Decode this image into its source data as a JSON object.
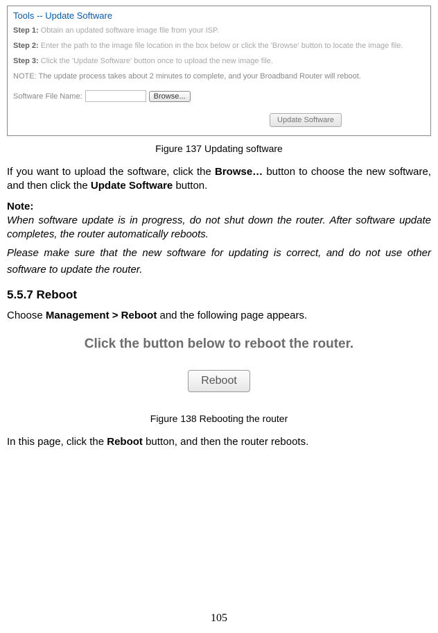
{
  "screenshot1": {
    "title": "Tools -- Update Software",
    "step1_label": "Step 1:",
    "step1_text": "Obtain an updated software image file from your ISP.",
    "step2_label": "Step 2:",
    "step2_text": "Enter the path to the image file location in the box below or click the 'Browse' button to locate the image file.",
    "step3_label": "Step 3:",
    "step3_text": "Click the 'Update Software' button once to upload the new image file.",
    "note_text": "NOTE: The update process takes about 2 minutes to complete, and your Broadband Router will reboot.",
    "file_label": "Software File Name:",
    "file_value": "",
    "browse_label": "Browse...",
    "update_label": "Update Software"
  },
  "figure137": "Figure 137 Updating software",
  "para_upload_pre": "If you want to upload the software, click the ",
  "para_upload_bold1": "Browse…",
  "para_upload_mid": " button to choose the new software, and then click the ",
  "para_upload_bold2": "Update Software",
  "para_upload_post": " button.",
  "note_head": "Note:",
  "note_body1": "When software update is in progress, do not shut down the router. After software update completes, the router automatically reboots.",
  "note_body2": "Please make sure that the new software for updating is correct, and do not use other software to update the router.",
  "section_head": "5.5.7  Reboot",
  "reboot_intro_pre": "Choose ",
  "reboot_intro_bold": "Management > Reboot",
  "reboot_intro_post": " and the following page appears.",
  "screenshot2": {
    "title": "Click the button below to reboot the router.",
    "button_label": "Reboot"
  },
  "figure138": "Figure 138 Rebooting the router",
  "reboot_use_pre": "In this page, click the ",
  "reboot_use_bold": "Reboot",
  "reboot_use_post": " button, and then the router reboots.",
  "page_number": "105"
}
